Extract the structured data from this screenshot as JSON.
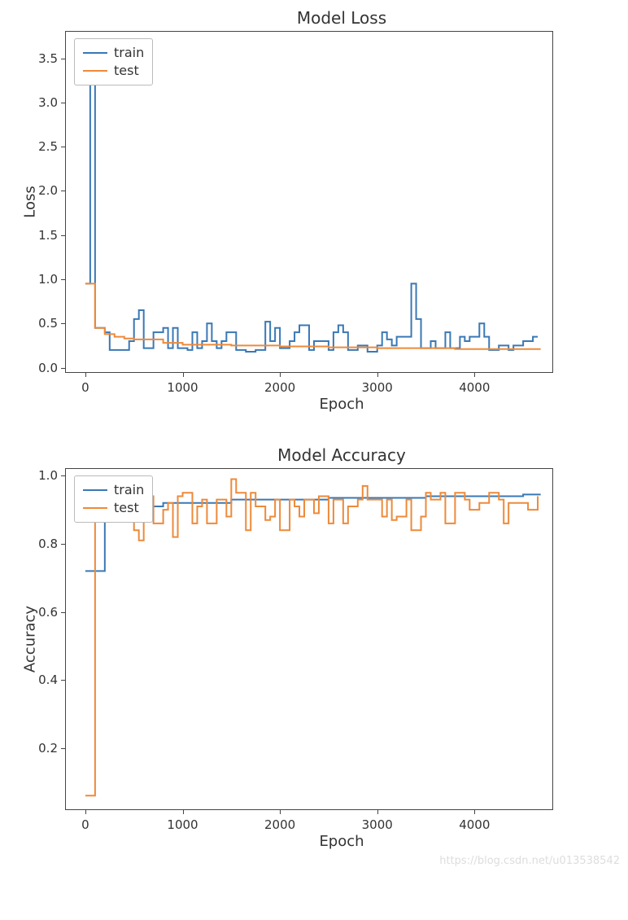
{
  "chart_data": [
    {
      "type": "line",
      "title": "Model Loss",
      "xlabel": "Epoch",
      "ylabel": "Loss",
      "xlim": [
        -200,
        4800
      ],
      "ylim": [
        -0.05,
        3.8
      ],
      "xticks": [
        0,
        1000,
        2000,
        3000,
        4000
      ],
      "yticks": [
        0.0,
        0.5,
        1.0,
        1.5,
        2.0,
        2.5,
        3.0,
        3.5
      ],
      "legend": {
        "position": "upper left",
        "entries": [
          "train",
          "test"
        ]
      },
      "series": [
        {
          "name": "train",
          "color": "#3a78b5",
          "x": [
            0,
            50,
            100,
            150,
            200,
            250,
            300,
            350,
            400,
            450,
            500,
            550,
            600,
            650,
            700,
            750,
            800,
            850,
            900,
            950,
            1000,
            1050,
            1100,
            1150,
            1200,
            1250,
            1300,
            1350,
            1400,
            1450,
            1500,
            1550,
            1600,
            1650,
            1700,
            1750,
            1800,
            1850,
            1900,
            1950,
            2000,
            2050,
            2100,
            2150,
            2200,
            2250,
            2300,
            2350,
            2400,
            2450,
            2500,
            2550,
            2600,
            2650,
            2700,
            2750,
            2800,
            2850,
            2900,
            2950,
            3000,
            3050,
            3100,
            3150,
            3200,
            3250,
            3300,
            3350,
            3400,
            3450,
            3500,
            3550,
            3600,
            3650,
            3700,
            3750,
            3800,
            3850,
            3900,
            3950,
            4000,
            4050,
            4100,
            4150,
            4200,
            4250,
            4300,
            4350,
            4400,
            4450,
            4500,
            4550,
            4600,
            4650
          ],
          "values": [
            0.95,
            3.7,
            0.45,
            0.45,
            0.4,
            0.2,
            0.2,
            0.2,
            0.2,
            0.3,
            0.55,
            0.65,
            0.22,
            0.22,
            0.4,
            0.4,
            0.45,
            0.22,
            0.45,
            0.22,
            0.22,
            0.2,
            0.4,
            0.22,
            0.3,
            0.5,
            0.3,
            0.22,
            0.3,
            0.4,
            0.4,
            0.2,
            0.2,
            0.18,
            0.18,
            0.2,
            0.2,
            0.52,
            0.3,
            0.45,
            0.22,
            0.22,
            0.3,
            0.4,
            0.48,
            0.48,
            0.2,
            0.3,
            0.3,
            0.3,
            0.2,
            0.4,
            0.48,
            0.4,
            0.2,
            0.2,
            0.25,
            0.25,
            0.18,
            0.18,
            0.25,
            0.4,
            0.32,
            0.25,
            0.35,
            0.35,
            0.35,
            0.95,
            0.55,
            0.22,
            0.22,
            0.3,
            0.22,
            0.22,
            0.4,
            0.22,
            0.22,
            0.35,
            0.3,
            0.35,
            0.35,
            0.5,
            0.35,
            0.2,
            0.2,
            0.25,
            0.25,
            0.2,
            0.25,
            0.25,
            0.3,
            0.3,
            0.35,
            0.35
          ]
        },
        {
          "name": "test",
          "color": "#ed8a3a",
          "x": [
            0,
            100,
            200,
            300,
            400,
            500,
            800,
            1000,
            1500,
            2000,
            2500,
            3000,
            3500,
            3800,
            4000,
            4200,
            4500,
            4680
          ],
          "values": [
            0.95,
            0.45,
            0.38,
            0.35,
            0.33,
            0.32,
            0.28,
            0.26,
            0.25,
            0.24,
            0.23,
            0.22,
            0.22,
            0.21,
            0.21,
            0.21,
            0.21,
            0.21
          ]
        }
      ]
    },
    {
      "type": "line",
      "title": "Model Accuracy",
      "xlabel": "Epoch",
      "ylabel": "Accuracy",
      "xlim": [
        -200,
        4800
      ],
      "ylim": [
        0.02,
        1.02
      ],
      "xticks": [
        0,
        1000,
        2000,
        3000,
        4000
      ],
      "yticks": [
        0.2,
        0.4,
        0.6,
        0.8,
        1.0
      ],
      "legend": {
        "position": "upper left",
        "entries": [
          "train",
          "test"
        ]
      },
      "series": [
        {
          "name": "train",
          "color": "#3a78b5",
          "x": [
            0,
            100,
            200,
            300,
            400,
            500,
            800,
            1000,
            1500,
            2000,
            2500,
            3000,
            3500,
            4000,
            4500,
            4680
          ],
          "values": [
            0.72,
            0.72,
            0.9,
            0.9,
            0.91,
            0.91,
            0.92,
            0.92,
            0.93,
            0.93,
            0.935,
            0.935,
            0.94,
            0.94,
            0.945,
            0.945
          ]
        },
        {
          "name": "test",
          "color": "#ed8a3a",
          "x": [
            0,
            50,
            100,
            150,
            200,
            250,
            300,
            350,
            400,
            450,
            500,
            550,
            600,
            650,
            700,
            750,
            800,
            850,
            900,
            950,
            1000,
            1050,
            1100,
            1150,
            1200,
            1250,
            1300,
            1350,
            1400,
            1450,
            1500,
            1550,
            1600,
            1650,
            1700,
            1750,
            1800,
            1850,
            1900,
            1950,
            2000,
            2050,
            2100,
            2150,
            2200,
            2250,
            2300,
            2350,
            2400,
            2450,
            2500,
            2550,
            2600,
            2650,
            2700,
            2750,
            2800,
            2850,
            2900,
            2950,
            3000,
            3050,
            3100,
            3150,
            3200,
            3250,
            3300,
            3350,
            3400,
            3450,
            3500,
            3550,
            3600,
            3650,
            3700,
            3750,
            3800,
            3850,
            3900,
            3950,
            4000,
            4050,
            4100,
            4150,
            4200,
            4250,
            4300,
            4350,
            4400,
            4450,
            4500,
            4550,
            4600,
            4650
          ],
          "values": [
            0.06,
            0.06,
            0.87,
            0.9,
            0.9,
            0.93,
            0.92,
            0.93,
            0.93,
            0.9,
            0.84,
            0.81,
            0.93,
            0.94,
            0.86,
            0.86,
            0.9,
            0.92,
            0.82,
            0.94,
            0.95,
            0.95,
            0.86,
            0.91,
            0.93,
            0.86,
            0.86,
            0.93,
            0.93,
            0.88,
            0.99,
            0.95,
            0.95,
            0.84,
            0.95,
            0.91,
            0.91,
            0.87,
            0.88,
            0.93,
            0.84,
            0.84,
            0.93,
            0.91,
            0.88,
            0.93,
            0.93,
            0.89,
            0.94,
            0.94,
            0.86,
            0.93,
            0.93,
            0.86,
            0.91,
            0.91,
            0.93,
            0.97,
            0.93,
            0.93,
            0.93,
            0.88,
            0.93,
            0.87,
            0.88,
            0.88,
            0.93,
            0.84,
            0.84,
            0.88,
            0.95,
            0.93,
            0.93,
            0.95,
            0.86,
            0.86,
            0.95,
            0.95,
            0.93,
            0.9,
            0.9,
            0.92,
            0.92,
            0.95,
            0.95,
            0.93,
            0.86,
            0.92,
            0.92,
            0.92,
            0.92,
            0.9,
            0.9,
            0.94
          ]
        }
      ]
    }
  ],
  "watermark": "https://blog.csdn.net/u013538542"
}
